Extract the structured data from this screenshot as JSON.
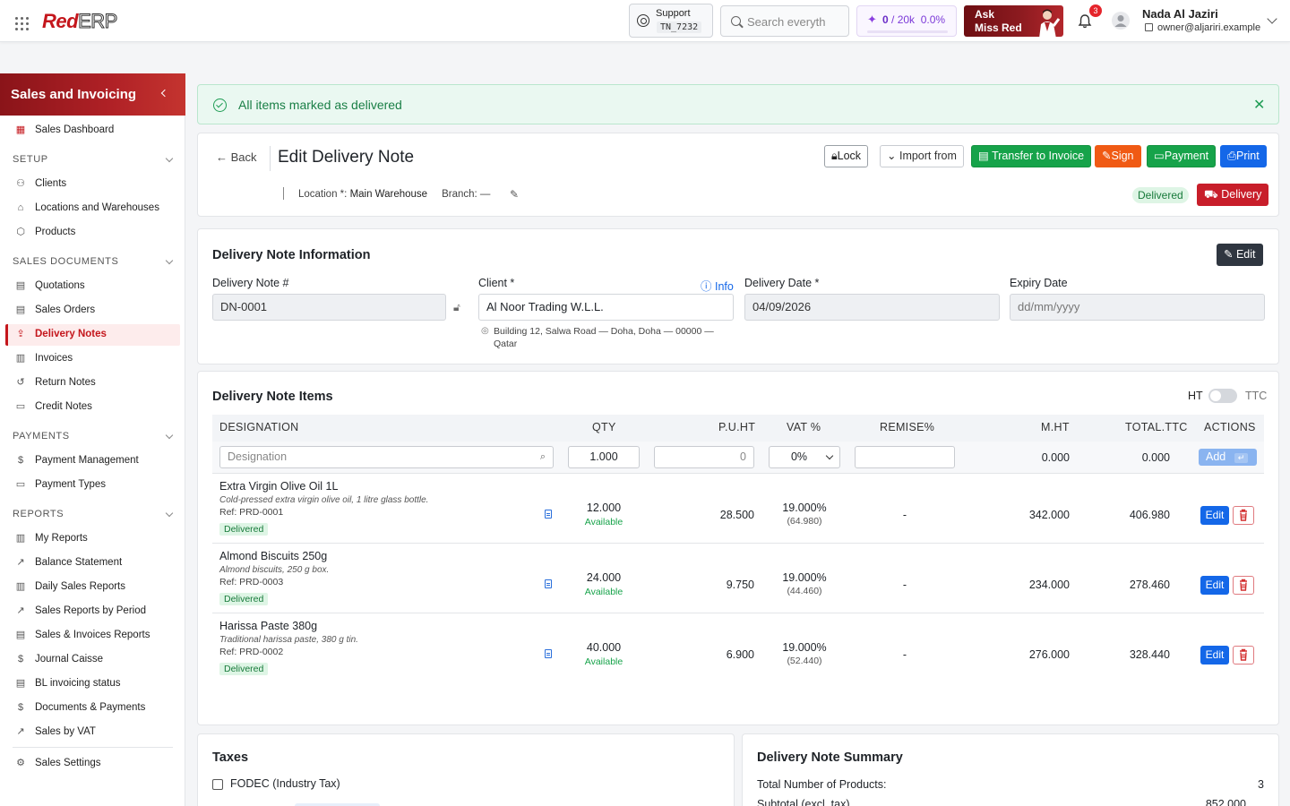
{
  "topbar": {
    "logo_red": "Red",
    "logo_erp": "ERP",
    "support_label": "Support",
    "support_code": "TN_7232",
    "search_placeholder": "Search everyth",
    "quota_used": "0",
    "quota_total": "/ 20k",
    "quota_percent": "0.0%",
    "quota_progress": 0,
    "ask_line1": "Ask",
    "ask_line2": "Miss Red",
    "notifications_count": "3",
    "user_name": "Nada Al Jaziri",
    "user_email": "owner@aljariri.example"
  },
  "sidebar": {
    "title": "Sales and Invoicing",
    "dashboard": "Sales Dashboard",
    "sections": {
      "setup": "SETUP",
      "sales_documents": "SALES DOCUMENTS",
      "payments": "PAYMENTS",
      "reports": "REPORTS"
    },
    "setup_items": [
      "Clients",
      "Locations and Warehouses",
      "Products"
    ],
    "sales_items": [
      "Quotations",
      "Sales Orders",
      "Delivery Notes",
      "Invoices",
      "Return Notes",
      "Credit Notes"
    ],
    "payment_items": [
      "Payment Management",
      "Payment Types"
    ],
    "report_items": [
      "My Reports",
      "Balance Statement",
      "Daily Sales Reports",
      "Sales Reports by Period",
      "Sales & Invoices Reports",
      "Journal Caisse",
      "BL invoicing status",
      "Documents & Payments",
      "Sales by VAT"
    ],
    "settings": "Sales Settings",
    "active": "Delivery Notes"
  },
  "alert": {
    "message": "All items marked as delivered"
  },
  "header": {
    "back": "Back",
    "title": "Edit Delivery Note",
    "lock": "Lock",
    "import_from": "Import from",
    "transfer": "Transfer to Invoice",
    "sign": "Sign",
    "payment": "Payment",
    "print": "Print",
    "location_label": "Location *:",
    "location_value": "Main Warehouse",
    "branch_label": "Branch:",
    "branch_value": "—",
    "status": "Delivered",
    "delivery_button": "Delivery"
  },
  "info": {
    "title": "Delivery Note Information",
    "edit": "Edit",
    "note_no_label": "Delivery Note #",
    "note_no": "DN-0001",
    "client_label": "Client *",
    "client_info": "Info",
    "client": "Al Noor Trading W.L.L.",
    "address_line1": "Building 12, Salwa Road — Doha, Doha — 00000 —",
    "address_line2": "Qatar",
    "date_label": "Delivery Date *",
    "date": "04/09/2026",
    "expiry_label": "Expiry Date",
    "expiry_placeholder": "dd/mm/yyyy"
  },
  "items": {
    "title": "Delivery Note Items",
    "ht": "HT",
    "ttc": "TTC",
    "columns": [
      "DESIGNATION",
      "QTY",
      "P.U.HT",
      "VAT %",
      "REMISE%",
      "M.HT",
      "TOTAL.TTC",
      "ACTIONS"
    ],
    "entry": {
      "designation_placeholder": "Designation",
      "qty": "1.000",
      "price": "0",
      "vat": "0%",
      "mht": "0.000",
      "total": "0.000",
      "add": "Add"
    },
    "rows": [
      {
        "name": "Extra Virgin Olive Oil 1L",
        "desc": "Cold-pressed extra virgin olive oil, 1 litre glass bottle.",
        "ref": "Ref: PRD-0001",
        "status": "Delivered",
        "qty": "12.000",
        "avail": "Available",
        "price": "28.500",
        "vat": "19.000%",
        "vat_amount": "(64.980)",
        "remise": "-",
        "mht": "342.000",
        "total": "406.980",
        "edit": "Edit"
      },
      {
        "name": "Almond Biscuits 250g",
        "desc": "Almond biscuits, 250 g box.",
        "ref": "Ref: PRD-0003",
        "status": "Delivered",
        "qty": "24.000",
        "avail": "Available",
        "price": "9.750",
        "vat": "19.000%",
        "vat_amount": "(44.460)",
        "remise": "-",
        "mht": "234.000",
        "total": "278.460",
        "edit": "Edit"
      },
      {
        "name": "Harissa Paste 380g",
        "desc": "Traditional harissa paste, 380 g tin.",
        "ref": "Ref: PRD-0002",
        "status": "Delivered",
        "qty": "40.000",
        "avail": "Available",
        "price": "6.900",
        "vat": "19.000%",
        "vat_amount": "(52.440)",
        "remise": "-",
        "mht": "276.000",
        "total": "328.440",
        "edit": "Edit"
      }
    ]
  },
  "taxes": {
    "title": "Taxes",
    "fodec": "FODEC (Industry Tax)"
  },
  "summary": {
    "title": "Delivery Note Summary",
    "total_products_label": "Total Number of Products:",
    "total_products": "3",
    "subtotal_label": "Subtotal (excl. tax)",
    "subtotal": "852.000"
  }
}
